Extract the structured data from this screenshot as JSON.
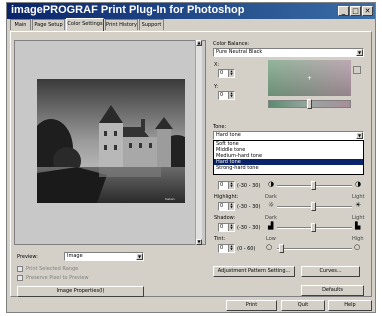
{
  "window": {
    "title": "imagePROGRAF Print Plug-In for Photoshop",
    "controls": [
      "_",
      "□",
      "✕"
    ]
  },
  "tabs": [
    {
      "label": "Main"
    },
    {
      "label": "Page Setup"
    },
    {
      "label": "Color Settings"
    },
    {
      "label": "Print History"
    },
    {
      "label": "Support"
    }
  ],
  "photo_watermark": "Canon",
  "preview": {
    "label": "Preview:",
    "value": "Image"
  },
  "checkboxes": [
    {
      "label": "Print Selected Range"
    },
    {
      "label": "Preserve Pixel to Preview"
    }
  ],
  "image_properties_button": "Image Properties(I)",
  "color_balance": {
    "label": "Color Balance:",
    "value": "Pure Neutral Black",
    "x_label": "X:",
    "x_value": "0",
    "y_label": "Y:",
    "y_value": "0"
  },
  "tone": {
    "label": "Tone:",
    "value": "Hard tone",
    "options": [
      "Soft tone",
      "Middle tone",
      "Medium-hard tone",
      "Hard tone",
      "Strong-hard tone"
    ],
    "selected_index": 3
  },
  "adjust": {
    "range": "(-30 - 30)",
    "brightness": {
      "value": "0",
      "left_icon": "◑",
      "right_icon": "◑"
    },
    "highlight": {
      "label": "Highlight:",
      "value": "0",
      "dark": "Dark",
      "light": "Light"
    },
    "shadow": {
      "label": "Shadow:",
      "value": "0",
      "dark": "Dark",
      "light": "Light"
    },
    "tint": {
      "label": "Tint:",
      "value": "0",
      "range": "(0 - 60)",
      "low": "Low",
      "high": "High"
    }
  },
  "buttons": {
    "adjustment_pattern": "Adjustment Pattern Setting...",
    "curves": "Curves...",
    "defaults": "Defaults",
    "print": "Print",
    "quit": "Quit",
    "help": "Help"
  }
}
